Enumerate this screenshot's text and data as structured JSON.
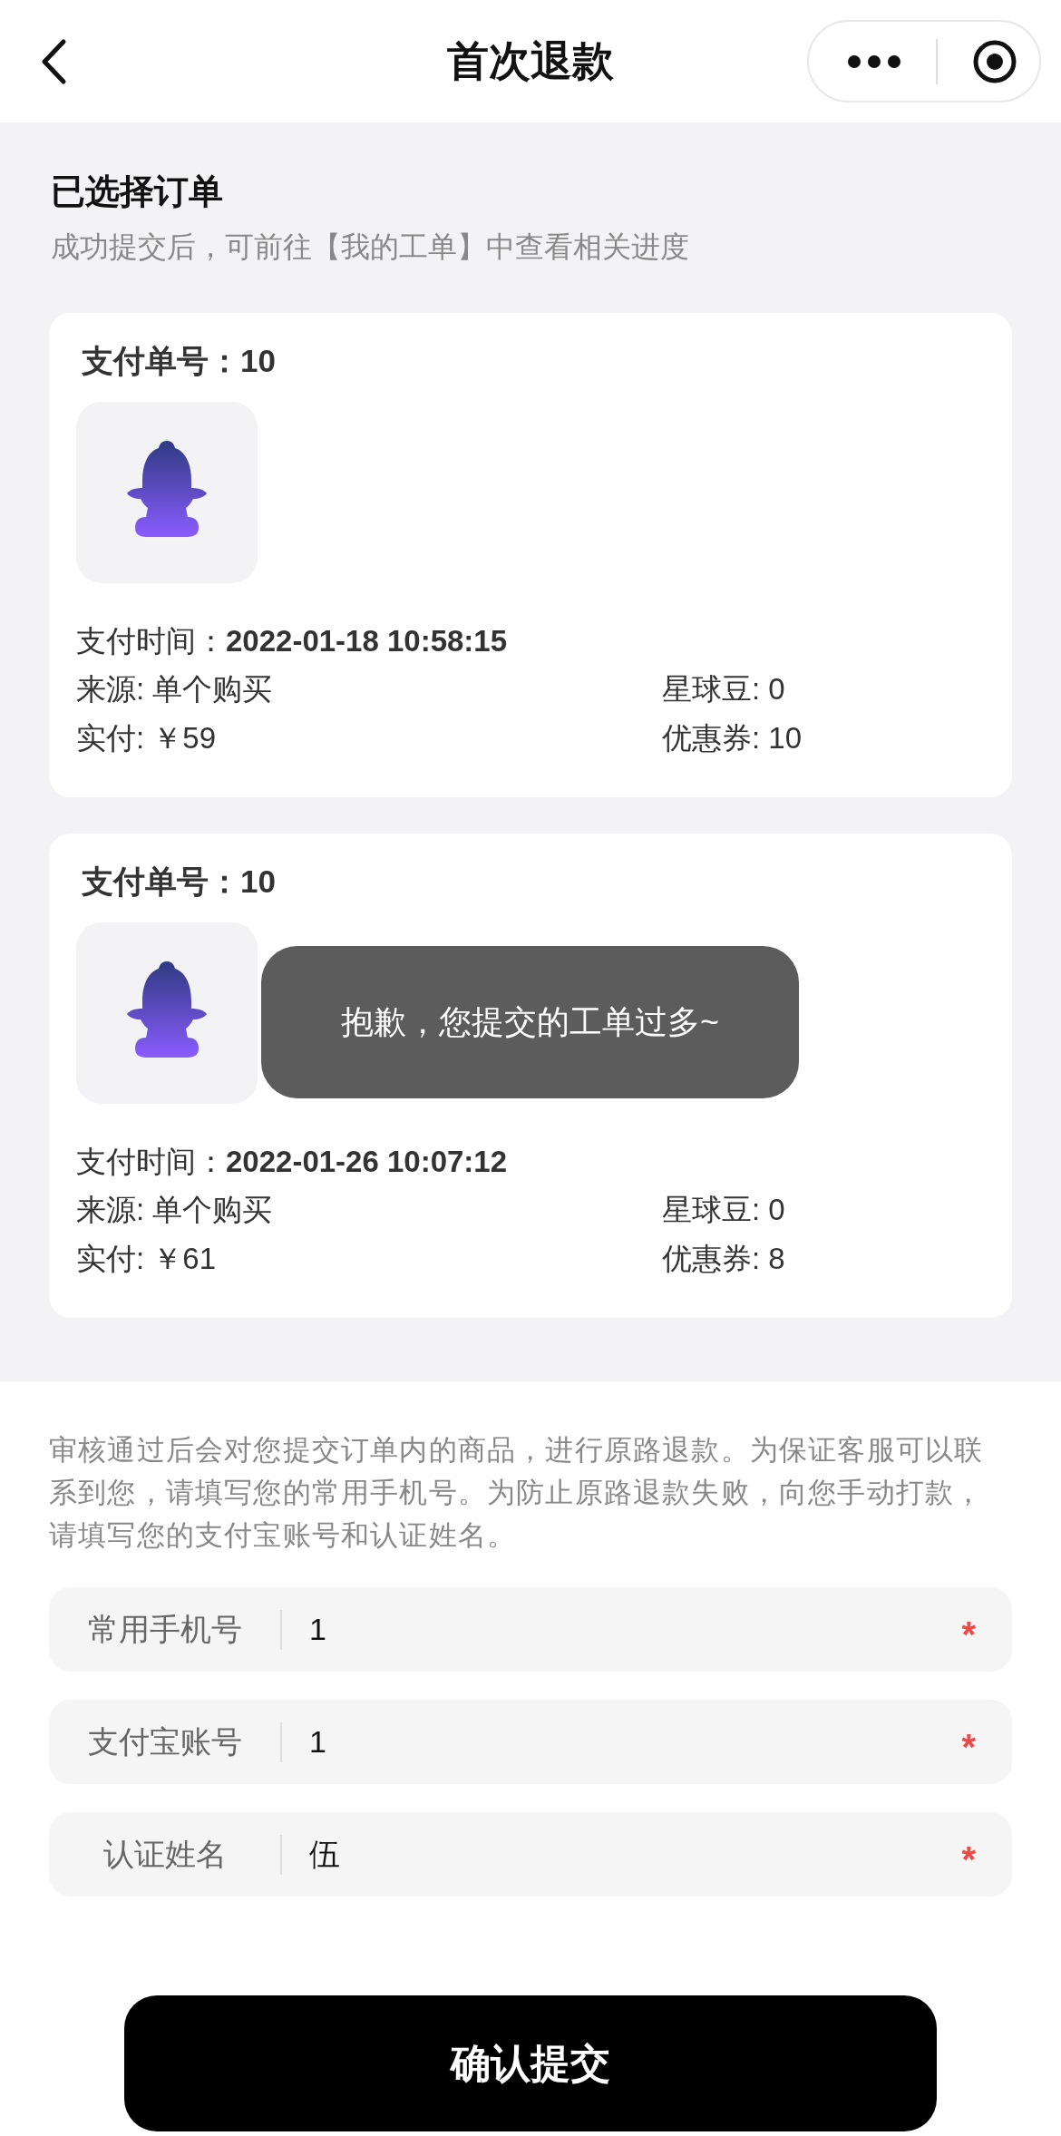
{
  "nav": {
    "title": "首次退款"
  },
  "section": {
    "title": "已选择订单",
    "subtitle": "成功提交后，可前往【我的工单】中查看相关进度"
  },
  "orders": [
    {
      "order_no_label": "支付单号：",
      "order_no": "10",
      "pay_time_label": "支付时间：",
      "pay_time": "2022-01-18 10:58:15",
      "source": "来源: 单个购买",
      "beans": "星球豆: 0",
      "paid": "实付: ￥59",
      "coupon": "优惠券: 10"
    },
    {
      "order_no_label": "支付单号：",
      "order_no": "10",
      "pay_time_label": "支付时间：",
      "pay_time": "2022-01-26 10:07:12",
      "source": "来源: 单个购买",
      "beans": "星球豆: 0",
      "paid": "实付: ￥61",
      "coupon": "优惠券: 8"
    }
  ],
  "toast": "抱歉，您提交的工单过多~",
  "notice": "审核通过后会对您提交订单内的商品，进行原路退款。为保证客服可以联系到您，请填写您的常用手机号。为防止原路退款失败，向您手动打款，请填写您的支付宝账号和认证姓名。",
  "fields": [
    {
      "label": "常用手机号",
      "value": "1",
      "required_mark": "*"
    },
    {
      "label": "支付宝账号",
      "value": "1",
      "required_mark": "*"
    },
    {
      "label": "认证姓名",
      "value": "伍",
      "required_mark": "*"
    }
  ],
  "submit": "确认提交"
}
